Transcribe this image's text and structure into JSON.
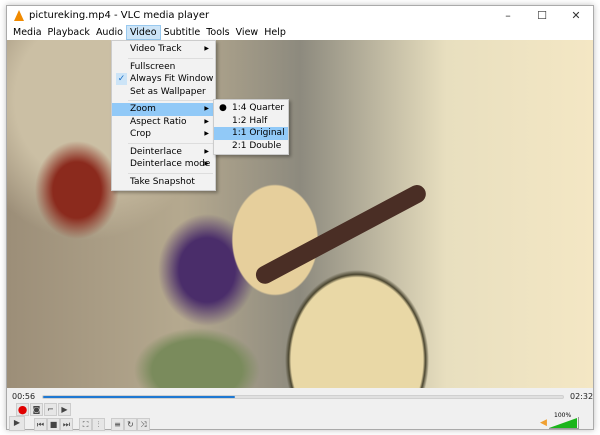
{
  "window": {
    "title": "pictureking.mp4 - VLC media player",
    "minimize": "–",
    "maximize": "☐",
    "close": "✕"
  },
  "menubar": [
    "Media",
    "Playback",
    "Audio",
    "Video",
    "Subtitle",
    "Tools",
    "View",
    "Help"
  ],
  "video_menu": {
    "items": [
      {
        "label": "Video Track",
        "submenu": true
      },
      {
        "sep": true
      },
      {
        "label": "Fullscreen"
      },
      {
        "label": "Always Fit Window",
        "checked": true
      },
      {
        "label": "Set as Wallpaper"
      },
      {
        "sep": true
      },
      {
        "label": "Zoom",
        "submenu": true,
        "highlighted": true
      },
      {
        "label": "Aspect Ratio",
        "submenu": true
      },
      {
        "label": "Crop",
        "submenu": true
      },
      {
        "sep": true
      },
      {
        "label": "Deinterlace",
        "submenu": true
      },
      {
        "label": "Deinterlace mode",
        "submenu": true
      },
      {
        "sep": true
      },
      {
        "label": "Take Snapshot"
      }
    ]
  },
  "zoom_menu": {
    "items": [
      {
        "label": "1:4 Quarter",
        "selected": true
      },
      {
        "label": "1:2 Half"
      },
      {
        "label": "1:1 Original",
        "highlighted": true
      },
      {
        "label": "2:1 Double"
      }
    ]
  },
  "player": {
    "elapsed": "00:56",
    "total": "02:32",
    "progress": 0.37,
    "volume_label": "100%",
    "volume": 1.0,
    "accent": "#1f78d1",
    "record_color": "#e00000"
  }
}
